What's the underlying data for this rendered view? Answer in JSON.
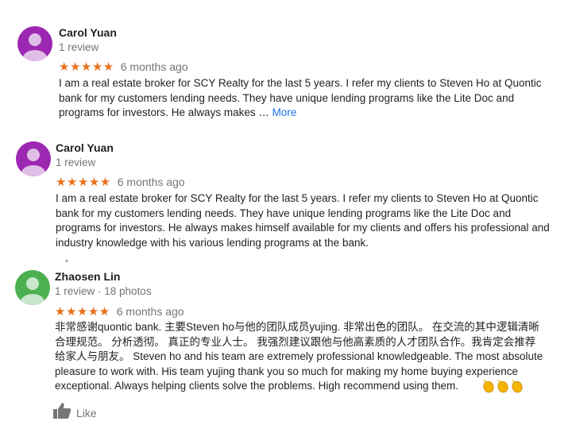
{
  "reviews": [
    {
      "name": "Carol Yuan",
      "meta": "1 review",
      "stars": "★★★★★",
      "date": "6 months ago",
      "avatar_color": "#8e24aa",
      "lines": [
        "I am a real estate broker for SCY Realty for the last 5 years. I refer my clients to Steven Ho at Quontic",
        "bank for my customers lending needs. They have unique lending programs like the Lite Doc and",
        "programs for investors. He always makes … "
      ],
      "more_label": "More"
    },
    {
      "name": "Carol Yuan",
      "meta": "1 review",
      "stars": "★★★★★",
      "date": "6 months ago",
      "avatar_color": "#8e24aa",
      "lines": [
        "I am a real estate broker for SCY Realty for the last 5 years. I refer my clients to Steven Ho at Quontic",
        "bank for my customers lending needs. They have unique lending programs like the Lite Doc and",
        "programs for investors. He always makes himself available for my clients and offers his professional and",
        "industry knowledge with his various lending programs at the bank."
      ]
    },
    {
      "name": "Zhaosen Lin",
      "meta": "1 review · 18 photos",
      "stars": "★★★★★",
      "date": "6 months ago",
      "avatar_color": "#43a047",
      "lines": [
        "非常感谢quontic bank.   主要Steven ho与他的团队成员yujing.  非常出色的团队。 在交流的其中逻辑清晰",
        "合理规范。  分析透彻。 真正的专业人士。   我强烈建议跟他与他高素质的人才团队合作。我肯定会推荐",
        "给家人与朋友。 Steven ho and his team are extremely professional knowledgeable. The most absolute",
        "pleasure to work with.   His team yujing thank you so much for making my home buying experience",
        "exceptional.   Always helping clients solve the problems.     High recommend using them.  "
      ]
    }
  ],
  "like_label": "Like",
  "icons": {
    "clap": "clapping-hands-icon",
    "like": "thumbs-up-icon"
  }
}
